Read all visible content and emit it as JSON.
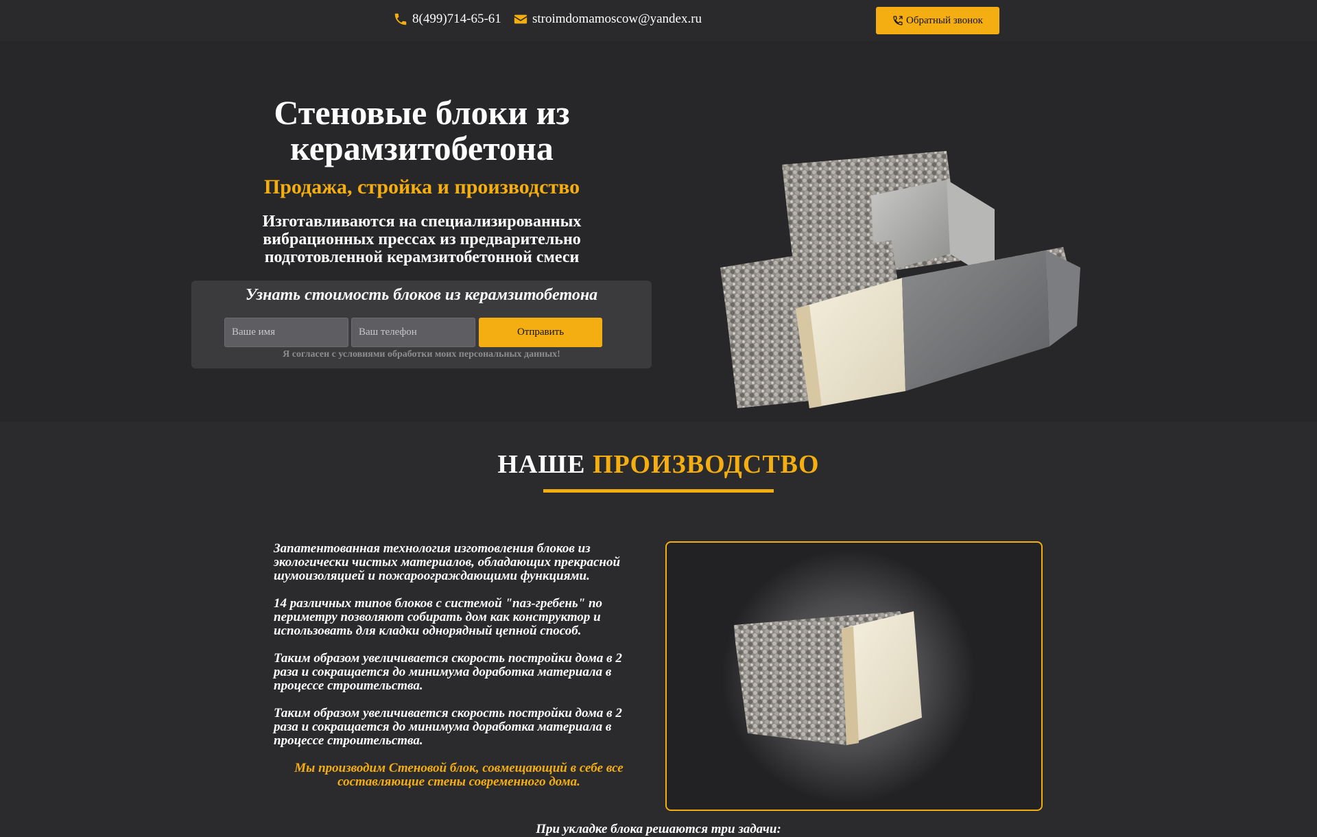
{
  "header": {
    "phone": "8(499)714-65-61",
    "email": "stroimdomamoscow@yandex.ru",
    "callback_label": "Обратный звонок",
    "phone_icon": "phone-icon",
    "mail_icon": "envelope-icon"
  },
  "hero": {
    "title": "Стеновые блоки из керамзитобетона",
    "subtitle": "Продажа, стройка и производство",
    "description": "Изготавливаются на специализированных вибрационных прессах из предварительно подготовленной керамзитобетонной смеси",
    "form": {
      "title": "Узнать стоимость блоков из керамзитобетона",
      "name_placeholder": "Ваше имя",
      "phone_placeholder": "Ваш телефон",
      "submit_label": "Отправить",
      "consent": "Я согласен с условиями обработки моих персональных данных!"
    }
  },
  "production": {
    "title_white": "НАШЕ",
    "title_accent": "ПРОИЗВОДСТВО",
    "paragraphs": [
      "Запатентованная технология изготовления блоков из экологически чистых материалов, обладающих прекрасной шумоизоляцией и пожароограждающими функциями.",
      "14 различных типов блоков с системой \"паз-гребень\" по периметру позволяют собирать дом как конструктор и использовать для кладки однорядный цепной способ.",
      "Таким образом увеличивается скорость постройки дома в 2 раза и сокращается до минимума доработка материала в процессе строительства.",
      "Таким образом увеличивается скорость постройки дома в 2 раза и сокращается до минимума доработка материала в процессе строительства."
    ],
    "accent_text": "Мы производим Стеновой блок, совмещающий в себе все составляющие стены современного дома.",
    "next_line": "При укладке блока решаются три задачи:"
  },
  "colors": {
    "accent": "#f5ae11",
    "background": "#2b2b2d",
    "form_bg": "#3b3b3e"
  }
}
